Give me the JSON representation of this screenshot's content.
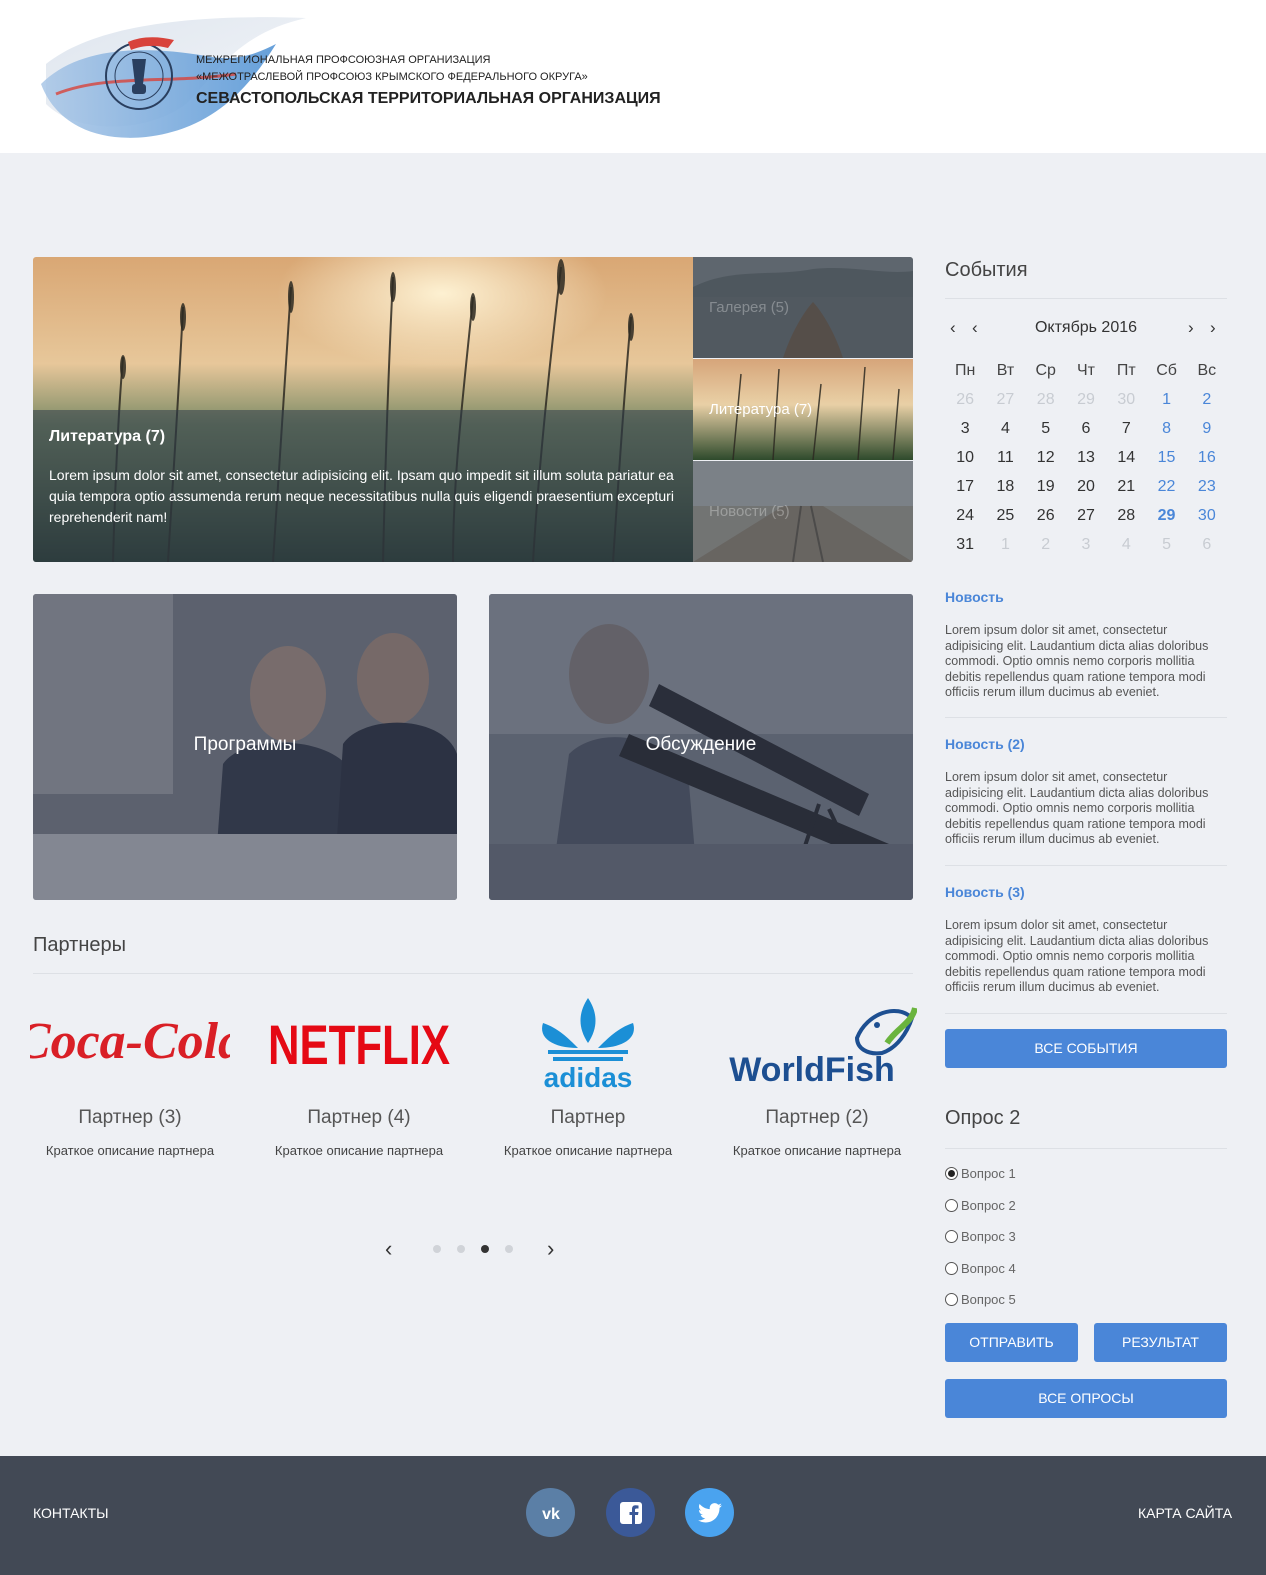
{
  "header": {
    "org_line1": "МЕЖРЕГИОНАЛЬНАЯ ПРОФСОЮЗНАЯ ОРГАНИЗАЦИЯ",
    "org_line2": "«МЕЖОТРАСЛЕВОЙ ПРОФСОЮЗ КРЫМСКОГО ФЕДЕРАЛЬНОГО ОКРУГА»",
    "org_line3": "СЕВАСТОПОЛЬСКАЯ ТЕРРИТОРИАЛЬНАЯ ОРГАНИЗАЦИЯ",
    "emblem_text": "МЕЖОТРАСЛЕВОЙ ПРОФСОЮЗ"
  },
  "slider": {
    "main_title": "Литература (7)",
    "main_text": "Lorem ipsum dolor sit amet, consectetur adipisicing elit. Ipsam quo impedit sit illum soluta pariatur ea quia tempora optio assumenda rerum neque necessitatibus nulla quis eligendi praesentium excepturi reprehenderit nam!",
    "thumbs": [
      {
        "label": "Галерея (5)"
      },
      {
        "label": "Литература (7)"
      },
      {
        "label": "Новости (5)"
      }
    ]
  },
  "tiles": {
    "programs": "Программы",
    "discussion": "Обсуждение"
  },
  "partners": {
    "title": "Партнеры",
    "items": [
      {
        "logo": "Coca-Cola",
        "name": "Партнер (3)",
        "desc": "Краткое описание партнера"
      },
      {
        "logo": "NETFLIX",
        "name": "Партнер (4)",
        "desc": "Краткое описание партнера"
      },
      {
        "logo": "adidas",
        "name": "Партнер",
        "desc": "Краткое описание партнера"
      },
      {
        "logo": "WorldFish",
        "name": "Партнер (2)",
        "desc": "Краткое описание партнера"
      }
    ],
    "active_dot": 3,
    "dot_count": 4
  },
  "events": {
    "title": "События",
    "calendar": {
      "month": "Октябрь 2016",
      "dow": [
        "Пн",
        "Вт",
        "Ср",
        "Чт",
        "Пт",
        "Сб",
        "Вс"
      ],
      "weeks": [
        [
          "26",
          "27",
          "28",
          "29",
          "30",
          "1",
          "2"
        ],
        [
          "3",
          "4",
          "5",
          "6",
          "7",
          "8",
          "9"
        ],
        [
          "10",
          "11",
          "12",
          "13",
          "14",
          "15",
          "16"
        ],
        [
          "17",
          "18",
          "19",
          "20",
          "21",
          "22",
          "23"
        ],
        [
          "24",
          "25",
          "26",
          "27",
          "28",
          "29",
          "30"
        ],
        [
          "31",
          "1",
          "2",
          "3",
          "4",
          "5",
          "6"
        ]
      ],
      "today": "29"
    },
    "news": [
      {
        "title": "Новость",
        "text": "Lorem ipsum dolor sit amet, consectetur adipisicing elit. Laudantium dicta alias doloribus commodi. Optio omnis nemo corporis mollitia debitis repellendus quam ratione tempora modi officiis rerum illum ducimus ab eveniet."
      },
      {
        "title": "Новость (2)",
        "text": "Lorem ipsum dolor sit amet, consectetur adipisicing elit. Laudantium dicta alias doloribus commodi. Optio omnis nemo corporis mollitia debitis repellendus quam ratione tempora modi officiis rerum illum ducimus ab eveniet."
      },
      {
        "title": "Новость (3)",
        "text": "Lorem ipsum dolor sit amet, consectetur adipisicing elit. Laudantium dicta alias doloribus commodi. Optio omnis nemo corporis mollitia debitis repellendus quam ratione tempora modi officiis rerum illum ducimus ab eveniet."
      }
    ],
    "all_button": "ВСЕ СОБЫТИЯ"
  },
  "poll": {
    "title": "Опрос 2",
    "options": [
      "Вопрос 1",
      "Вопрос 2",
      "Вопрос 3",
      "Вопрос 4",
      "Вопрос 5"
    ],
    "selected": 0,
    "submit": "ОТПРАВИТЬ",
    "results": "РЕЗУЛЬТАТ",
    "all_polls": "ВСЕ ОПРОСЫ"
  },
  "footer": {
    "contacts": "КОНТАКТЫ",
    "sitemap": "КАРТА САЙТА",
    "social": [
      "vk-icon",
      "facebook-icon",
      "twitter-icon"
    ]
  },
  "colors": {
    "accent": "#4a86d8",
    "footer_bg": "#424955",
    "page_bg": "#eef0f4"
  }
}
